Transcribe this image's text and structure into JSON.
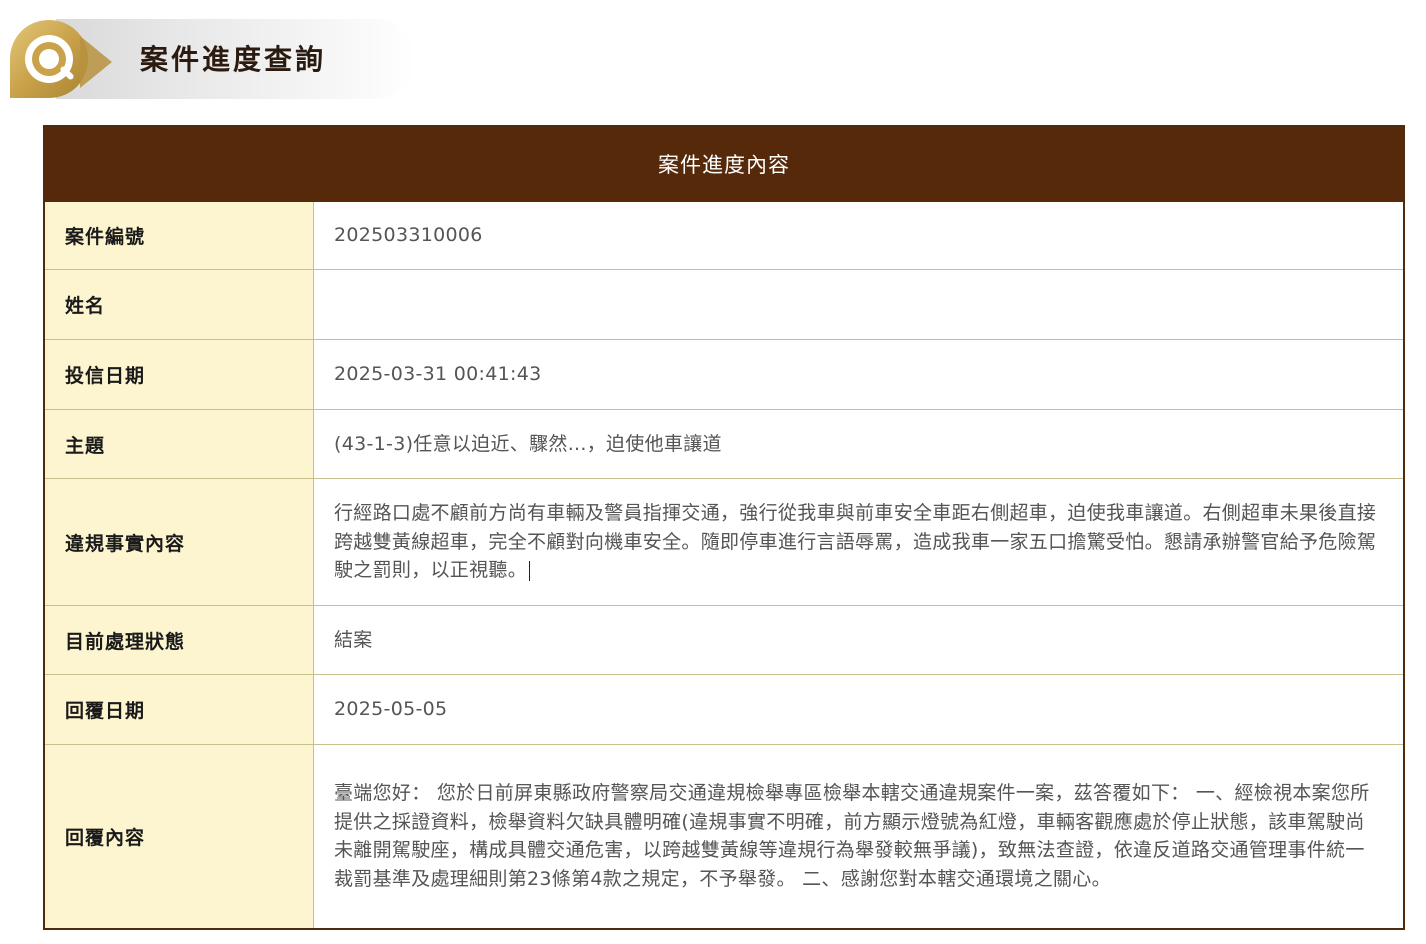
{
  "header": {
    "title": "案件進度查詢",
    "icon": "search-magnifier-icon",
    "accent_color": "#c9a24a"
  },
  "table": {
    "title": "案件進度內容",
    "header_color": "#55290a",
    "label_bg_color": "#fdf5cf",
    "rows": [
      {
        "label": "案件編號",
        "value": "202503310006"
      },
      {
        "label": "姓名",
        "value": ""
      },
      {
        "label": "投信日期",
        "value": "2025-03-31 00:41:43"
      },
      {
        "label": "主題",
        "value": "(43-1-3)任意以迫近、驟然...，迫使他車讓道"
      },
      {
        "label": "違規事實內容",
        "value": "行經路口處不顧前方尚有車輛及警員指揮交通，強行從我車與前車安全車距右側超車，迫使我車讓道。右側超車未果後直接跨越雙黃線超車，完全不顧對向機車安全。隨即停車進行言語辱罵，造成我車一家五口擔驚受怕。懇請承辦警官給予危險駕駛之罰則，以正視聽。"
      },
      {
        "label": "目前處理狀態",
        "value": "結案"
      },
      {
        "label": "回覆日期",
        "value": "2025-05-05"
      },
      {
        "label": "回覆內容",
        "value": "臺端您好： 您於日前屏東縣政府警察局交通違規檢舉專區檢舉本轄交通違規案件一案，茲答覆如下： 一、經檢視本案您所提供之採證資料，檢舉資料欠缺具體明確(違規事實不明確，前方顯示燈號為紅燈，車輛客觀應處於停止狀態，該車駕駛尚未離開駕駛座，構成具體交通危害，以跨越雙黃線等違規行為舉發較無爭議)，致無法查證，依違反道路交通管理事件統一裁罰基準及處理細則第23條第4款之規定，不予舉發。 二、感謝您對本轄交通環境之關心。"
      }
    ]
  }
}
